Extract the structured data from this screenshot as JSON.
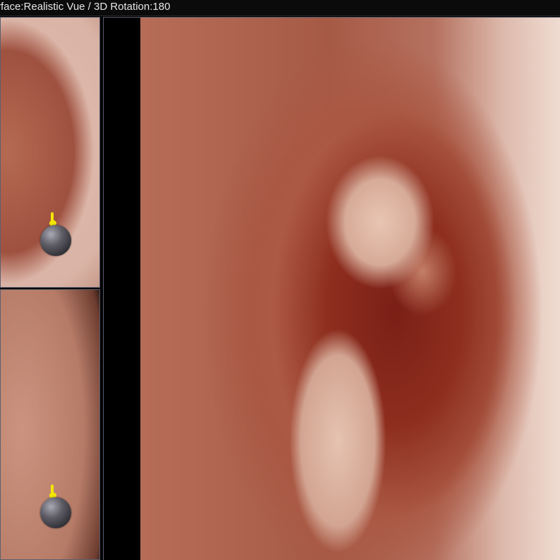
{
  "title_bar": {
    "text": "rface:Realistic Vue / 3D Rotation:180"
  },
  "viewports": {
    "top_left": {
      "marker_icon": "sphere-marker-icon"
    },
    "bottom_left": {
      "marker_icon": "sphere-marker-icon"
    },
    "main": {}
  },
  "colors": {
    "background": "#000000",
    "title_text": "#e6e6e6",
    "pane_border": "#5b5f70",
    "marker_pin": "#f2e600",
    "marker_ball": "#5e5d66"
  }
}
